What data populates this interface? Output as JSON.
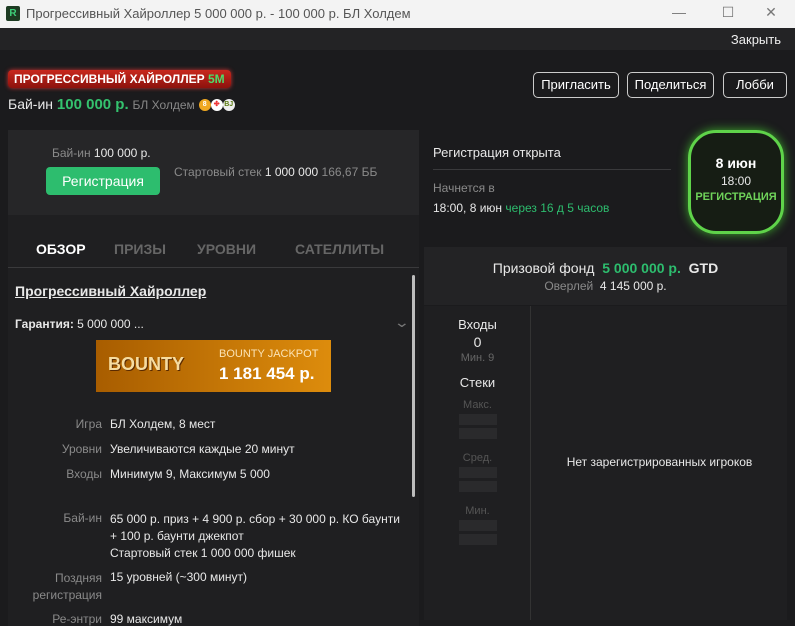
{
  "window": {
    "title": "Прогрессивный Хайроллер 5 000 000 р. - 100 000 р. БЛ Холдем",
    "logo": "R",
    "minimize": "—",
    "maximize": "☐",
    "close": "✕"
  },
  "topbar": {
    "close_label": "Закрыть"
  },
  "header": {
    "banner_text": "ПРОГРЕССИВНЫЙ ХАЙРОЛЛЕР",
    "banner_accent": "5M",
    "buyin_label": "Бай-ин",
    "buyin_value": "100 000 р.",
    "game": "БЛ Холдем",
    "chips": [
      "8",
      "✤",
      "BJ"
    ],
    "buttons": {
      "invite": "Пригласить",
      "share": "Поделиться",
      "lobby": "Лобби"
    }
  },
  "card": {
    "buyin_label": "Бай-ин",
    "buyin_value": "100 000 р.",
    "register": "Регистрация",
    "stack_label": "Стартовый стек",
    "stack_value": "1 000 000",
    "stack_bb": "166,67 ББ"
  },
  "tabs": [
    "ОБЗОР",
    "ПРИЗЫ",
    "УРОВНИ",
    "САТЕЛЛИТЫ"
  ],
  "overview": {
    "title": "Прогрессивный Хайроллер",
    "guarantee_label": "Гарантия:",
    "guarantee_value": "5 000 000 ...",
    "jackpot_logo": "BOUNTY",
    "jackpot_label": "BOUNTY JACKPOT",
    "jackpot_value": "1 181 454 р.",
    "rows": [
      {
        "label": "Игра",
        "value": "БЛ Холдем, 8 мест"
      },
      {
        "label": "Уровни",
        "value": "Увеличиваются каждые 20 минут"
      },
      {
        "label": "Входы",
        "value": "Минимум 9, Максимум 5 000"
      }
    ],
    "buyin_label": "Бай-ин",
    "buyin_line1": "65 000 р. приз + 4 900 р. сбор + 30 000 р. КО баунти",
    "buyin_line2": "+ 100 р. баунти джекпот",
    "buyin_line3": "Стартовый стек 1 000 000 фишек",
    "late_label1": "Поздняя",
    "late_label2": "регистрация",
    "late_value": "15 уровней (~300 минут)",
    "reentry_label": "Ре-энтри",
    "reentry_value": "99 максимум"
  },
  "registration": {
    "status": "Регистрация открыта",
    "starts_label": "Начнется в",
    "starts_value": "18:00, 8 июн",
    "countdown": "через 16 д 5 часов"
  },
  "badge": {
    "date": "8 июн",
    "time": "18:00",
    "status": "РЕГИСТРАЦИЯ"
  },
  "prize": {
    "label": "Призовой фонд",
    "value": "5 000 000 р.",
    "gtd": "GTD",
    "overlay_label": "Оверлей",
    "overlay_value": "4 145 000 р."
  },
  "stats": {
    "entries_label": "Входы",
    "entries_value": "0",
    "min_label": "Мин. 9",
    "stacks_label": "Стеки",
    "max": "Макс.",
    "avg": "Сред.",
    "min": "Мин."
  },
  "players": {
    "empty": "Нет зарегистрированных игроков"
  },
  "colors": {
    "accent": "#2dbd6e",
    "badge": "#5fd34a",
    "jackpot": "#dd8c0c"
  }
}
